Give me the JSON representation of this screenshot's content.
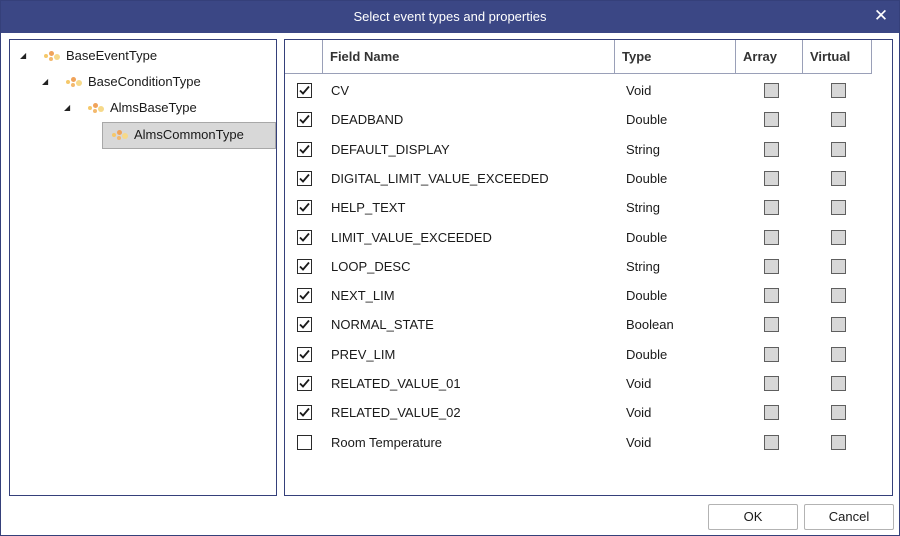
{
  "dialog": {
    "title": "Select event types and properties",
    "close_symbol": "✕",
    "ok_label": "OK",
    "cancel_label": "Cancel",
    "colors": {
      "title_bg": "#3b4785",
      "border": "#35407a",
      "selection_bg": "#d8d8d8"
    }
  },
  "tree": {
    "nodes": [
      {
        "label": "BaseEventType",
        "expanded": true,
        "icon": "event-type-icon"
      },
      {
        "label": "BaseConditionType",
        "expanded": true,
        "icon": "event-type-icon"
      },
      {
        "label": "AlmsBaseType",
        "expanded": true,
        "icon": "event-type-icon"
      },
      {
        "label": "AlmsCommonType",
        "selected": true,
        "icon": "event-type-icon"
      }
    ]
  },
  "grid": {
    "headers": {
      "field": "Field Name",
      "type": "Type",
      "array": "Array",
      "virtual": "Virtual"
    },
    "rows": [
      {
        "checked": true,
        "field": "CV",
        "type": "Void",
        "array": false,
        "virtual": false
      },
      {
        "checked": true,
        "field": "DEADBAND",
        "type": "Double",
        "array": false,
        "virtual": false
      },
      {
        "checked": true,
        "field": "DEFAULT_DISPLAY",
        "type": "String",
        "array": false,
        "virtual": false
      },
      {
        "checked": true,
        "field": "DIGITAL_LIMIT_VALUE_EXCEEDED",
        "type": "Double",
        "array": false,
        "virtual": false
      },
      {
        "checked": true,
        "field": "HELP_TEXT",
        "type": "String",
        "array": false,
        "virtual": false
      },
      {
        "checked": true,
        "field": "LIMIT_VALUE_EXCEEDED",
        "type": "Double",
        "array": false,
        "virtual": false
      },
      {
        "checked": true,
        "field": "LOOP_DESC",
        "type": "String",
        "array": false,
        "virtual": false
      },
      {
        "checked": true,
        "field": "NEXT_LIM",
        "type": "Double",
        "array": false,
        "virtual": false
      },
      {
        "checked": true,
        "field": "NORMAL_STATE",
        "type": "Boolean",
        "array": false,
        "virtual": false
      },
      {
        "checked": true,
        "field": "PREV_LIM",
        "type": "Double",
        "array": false,
        "virtual": false
      },
      {
        "checked": true,
        "field": "RELATED_VALUE_01",
        "type": "Void",
        "array": false,
        "virtual": false
      },
      {
        "checked": true,
        "field": "RELATED_VALUE_02",
        "type": "Void",
        "array": false,
        "virtual": false
      },
      {
        "checked": false,
        "field": "Room Temperature",
        "type": "Void",
        "array": false,
        "virtual": false
      }
    ]
  }
}
